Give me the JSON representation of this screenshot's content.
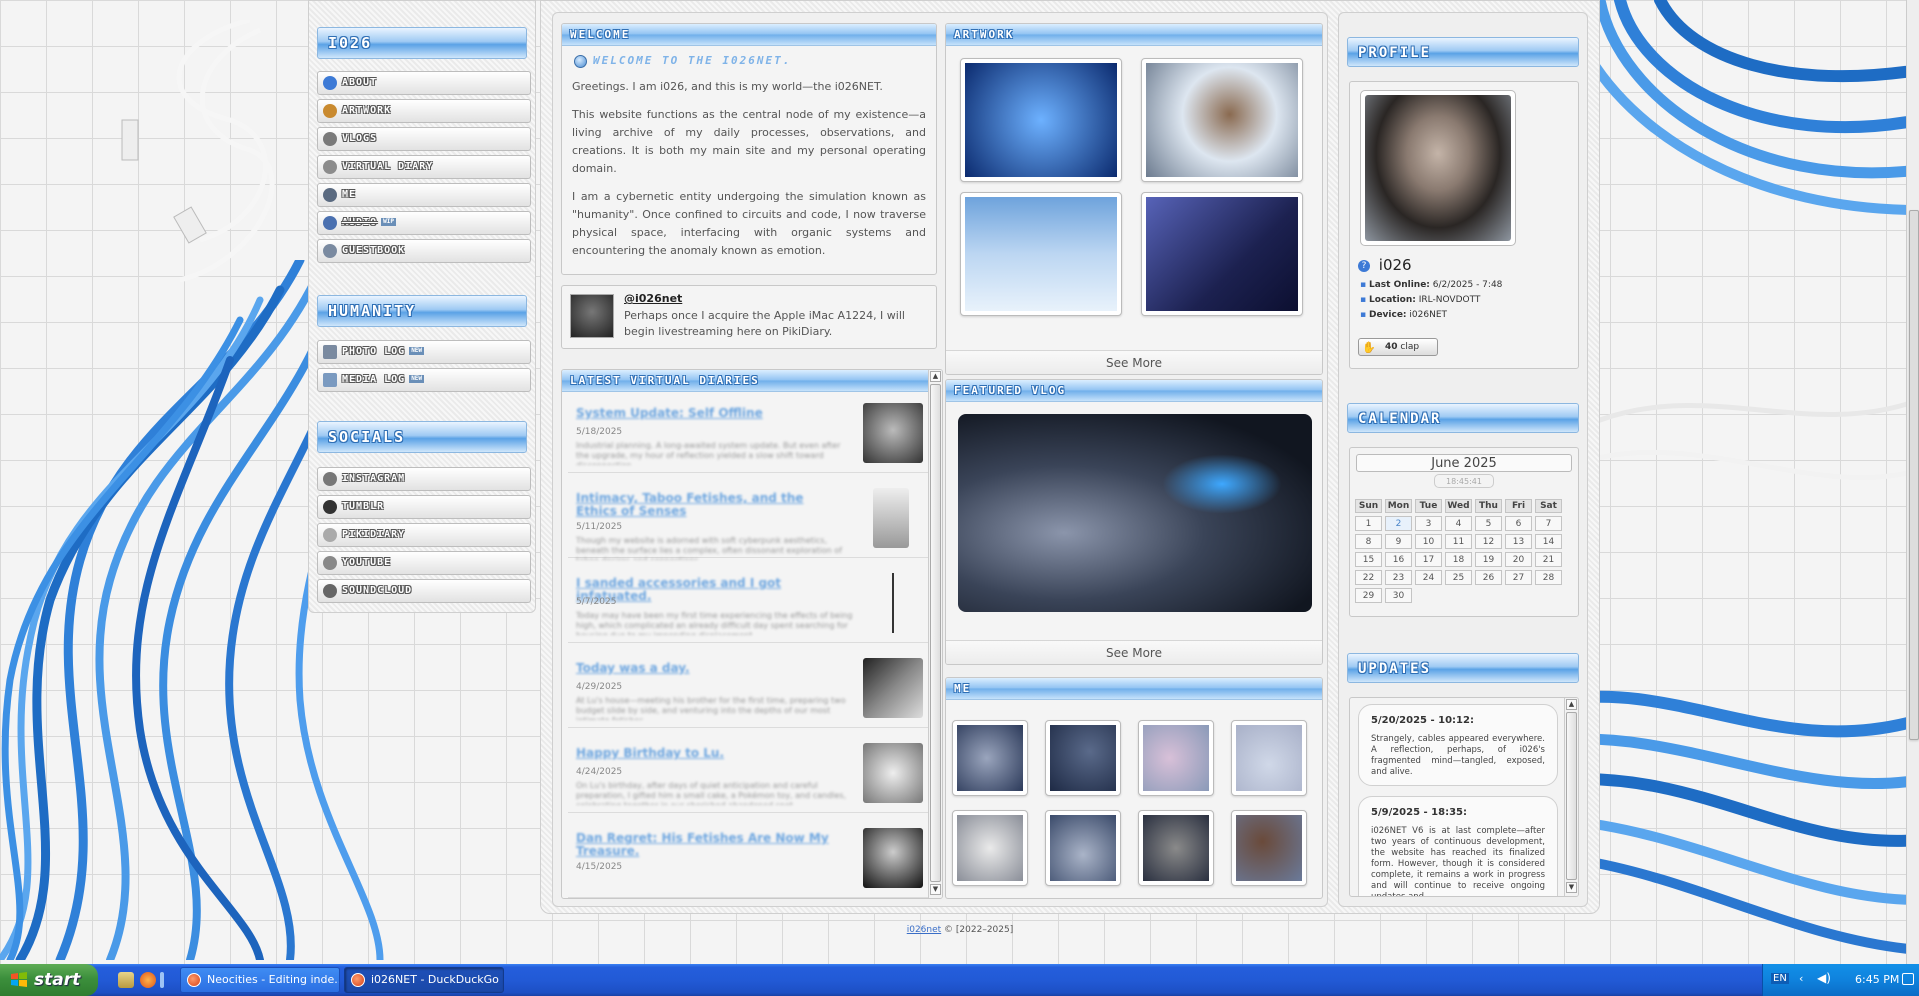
{
  "sidebar": {
    "title": "i026",
    "nav": [
      {
        "label": "About",
        "icon": "info-icon",
        "color": "#3d7ad6"
      },
      {
        "label": "Artwork",
        "icon": "palette-icon",
        "color": "#c98a2f"
      },
      {
        "label": "Vlogs",
        "icon": "camera-icon",
        "color": "#7a7a7a"
      },
      {
        "label": "Virtual Diary",
        "icon": "book-icon",
        "color": "#8c8c8c"
      },
      {
        "label": "Me",
        "icon": "person-icon",
        "color": "#5a6a80"
      },
      {
        "label": "Audio",
        "icon": "speaker-icon",
        "color": "#4a70b0",
        "tag": "WIP"
      },
      {
        "label": "Guestbook",
        "icon": "guestbook-icon",
        "color": "#7a8aa0"
      }
    ],
    "humanity_title": "Humanity",
    "humanity": [
      {
        "label": "Photo Log",
        "icon": "photo-icon",
        "color": "#7a8aa0",
        "tag": "NEW"
      },
      {
        "label": "Media Log",
        "icon": "media-icon",
        "color": "#7a9ac0",
        "tag": "NEW"
      }
    ],
    "socials_title": "Socials",
    "socials": [
      {
        "label": "Instagram",
        "icon": "instagram-icon",
        "color": "#777"
      },
      {
        "label": "Tumblr",
        "icon": "tumblr-icon",
        "color": "#333"
      },
      {
        "label": "PikiDiary",
        "icon": "pikidiary-icon",
        "color": "#aaa"
      },
      {
        "label": "YouTube",
        "icon": "youtube-icon",
        "color": "#888"
      },
      {
        "label": "SoundCloud",
        "icon": "soundcloud-icon",
        "color": "#666"
      }
    ]
  },
  "welcome": {
    "header": "Welcome",
    "title": "Welcome to the i026NET.",
    "p1": "Greetings. I am i026, and this is my world—the i026NET.",
    "p2": "This website functions as the central node of my existence—a living archive of my daily processes, observations, and creations. It is both my main site and my personal operating domain.",
    "p3": "I am a cybernetic entity undergoing the simulation known as \"humanity\". Once confined to circuits and code, I now traverse physical space, interfacing with organic systems and encountering the anomaly known as emotion."
  },
  "status_post": {
    "handle": "@i026net",
    "text": "Perhaps once I acquire the Apple iMac A1224, I will begin livestreaming here on PikiDiary."
  },
  "artwork": {
    "header": "Artwork",
    "see_more": "See More",
    "items": [
      {
        "alt": "robot-figure-blue-room",
        "c1": "#0b2a6e",
        "c2": "#3a7fe0"
      },
      {
        "alt": "girl-in-spacesuit",
        "c1": "#dde6f0",
        "c2": "#6c7b8f"
      },
      {
        "alt": "figure-in-sky-field",
        "c1": "#bcd6f2",
        "c2": "#e8f2fb"
      },
      {
        "alt": "girl-in-dark-alley",
        "c1": "#1c2150",
        "c2": "#5763b8"
      }
    ]
  },
  "diaries": {
    "header": "Latest Virtual Diaries",
    "items": [
      {
        "title": "System Update: Self Offline",
        "date": "5/18/2025",
        "summary": "Industrial planning. A long-awaited system update. But even after the upgrade, my hour of reflection yielded a slow shift toward disconnection.",
        "c": "#555"
      },
      {
        "title": "Intimacy, Taboo Fetishes, and the Ethics of Senses",
        "date": "5/11/2025",
        "summary": "Though my website is adorned with soft cyberpunk aesthetics, beneath the surface lies a complex, often dissonant exploration of taboo desires and connections.",
        "c": "#aaa"
      },
      {
        "title": "I sanded accessories and I got infatuated.",
        "date": "5/7/2025",
        "summary": "Today may have been my first time experiencing the effects of being high, which complicated an already difficult day spent searching for housing due to my impending displacement.",
        "c": "#ddd"
      },
      {
        "title": "Today was a day.",
        "date": "4/29/2025",
        "summary": "At Lu's house—meeting his brother for the first time, preparing two budget slide by side, and venturing into the depths of our most intimate fetishes.",
        "c": "#444"
      },
      {
        "title": "Happy Birthday to Lu.",
        "date": "4/24/2025",
        "summary": "On Lu's birthday, after days of quiet anticipation and careful preparation, I gifted him a small cake, a Pokémon toy, and candles, celebrating together in our cherished abandoned spot.",
        "c": "#bbb"
      },
      {
        "title": "Dan Regret: His Fetishes Are Now My Treasure.",
        "date": "4/15/2025",
        "summary": "",
        "c": "#333"
      }
    ]
  },
  "featured_vlog": {
    "header": "Featured Vlog",
    "see_more": "See More"
  },
  "me": {
    "header": "Me",
    "photos": [
      "#2c3a5a",
      "#1e2a45",
      "#8a9ab8",
      "#a8b0c8",
      "#c0c4cc",
      "#3a4a6a",
      "#2a3040",
      "#6a7a9a"
    ]
  },
  "profile": {
    "header": "Profile",
    "name": "i026",
    "last_online_label": "Last Online:",
    "last_online": "6/2/2025 - 7:48",
    "location_label": "Location:",
    "location": "IRL-NOVDOTT",
    "device_label": "Device:",
    "device": "i026NET",
    "clap_count": "40",
    "clap_label": "clap"
  },
  "calendar": {
    "header": "Calendar",
    "month": "June 2025",
    "time": "18:45:41",
    "days": [
      "Sun",
      "Mon",
      "Tue",
      "Wed",
      "Thu",
      "Fri",
      "Sat"
    ],
    "weeks": [
      [
        "1",
        "2",
        "3",
        "4",
        "5",
        "6",
        "7"
      ],
      [
        "8",
        "9",
        "10",
        "11",
        "12",
        "13",
        "14"
      ],
      [
        "15",
        "16",
        "17",
        "18",
        "19",
        "20",
        "21"
      ],
      [
        "22",
        "23",
        "24",
        "25",
        "26",
        "27",
        "28"
      ],
      [
        "29",
        "30",
        "",
        "",
        "",
        "",
        ""
      ]
    ],
    "today": "2"
  },
  "updates": {
    "header": "Updates",
    "items": [
      {
        "date": "5/20/2025 - 10:12:",
        "text": "Strangely, cables appeared everywhere. A reflection, perhaps, of i026's fragmented mind—tangled, exposed, and alive."
      },
      {
        "date": "5/9/2025 - 18:35:",
        "text": "i026NET V6 is at last complete—after two years of continuous development, the website has reached its finalized form. However, though it is considered complete, it remains a work in progress and will continue to receive ongoing updates and"
      }
    ]
  },
  "footer": {
    "link": "i026net",
    "text": " © [2022–2025]"
  },
  "taskbar": {
    "start": "start",
    "tasks": [
      {
        "label": "Neocities - Editing inde...",
        "active": false
      },
      {
        "label": "i026NET - DuckDuckGo",
        "active": true
      }
    ],
    "lang": "EN",
    "time": "6:45 PM"
  }
}
